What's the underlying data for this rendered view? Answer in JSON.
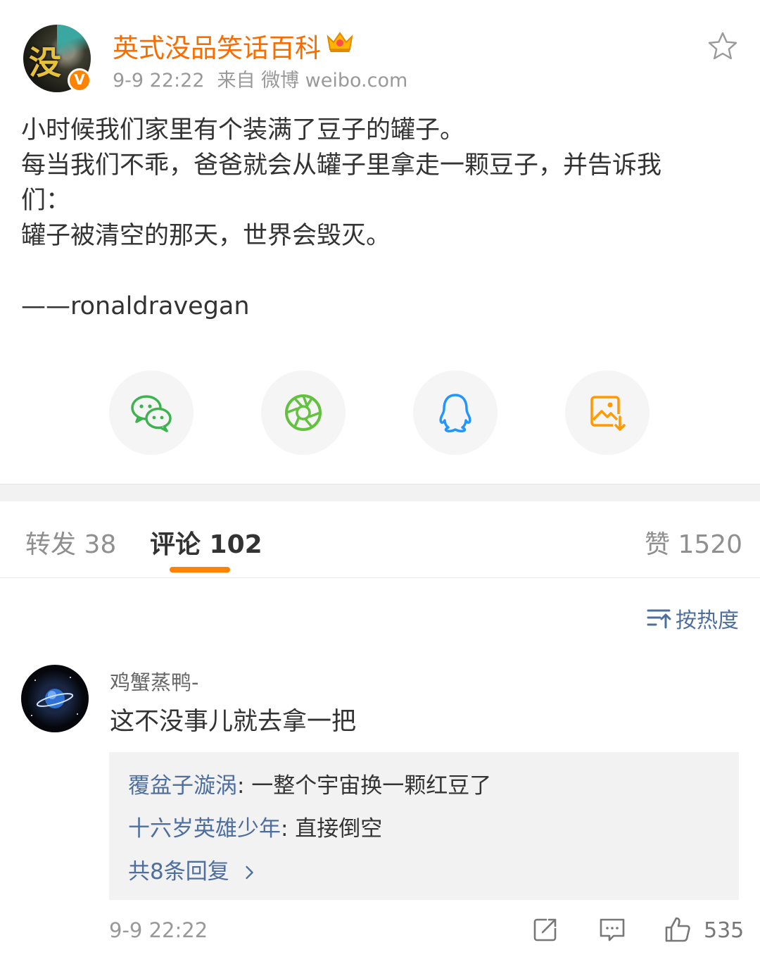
{
  "post": {
    "author": "英式没品笑话百科",
    "avatar_text": "没",
    "verified_badge": "V",
    "time": "9-9 22:22",
    "source": "来自 微博 weibo.com",
    "lines": [
      "小时候我们家里有个装满了豆子的罐子。",
      "每当我们不乖，爸爸就会从罐子里拿走一颗豆子，并告诉我",
      "们：",
      "罐子被清空的那天，世界会毁灭。",
      "",
      "——ronaldravegan"
    ]
  },
  "share_buttons": [
    {
      "icon": "wechat-icon",
      "color": "#3cb34f"
    },
    {
      "icon": "moments-icon",
      "color": "#62c13f"
    },
    {
      "icon": "qq-icon",
      "color": "#2395ff"
    },
    {
      "icon": "save-image-icon",
      "color": "#ff9a00"
    }
  ],
  "tabs": {
    "repost": "转发 38",
    "comments": "评论 102",
    "likes": "赞 1520"
  },
  "sort": {
    "label": "按热度"
  },
  "comment": {
    "user": "鸡蟹蒸鸭-",
    "text": "这不没事儿就去拿一把",
    "replies": [
      {
        "user": "覆盆子漩涡",
        "text": ": 一整个宇宙换一颗红豆了"
      },
      {
        "user": "十六岁英雄少年",
        "text": ": 直接倒空"
      }
    ],
    "more_replies": "共8条回复",
    "time": "9-9 22:22",
    "like_count": "535"
  },
  "colors": {
    "accent": "#ff8200",
    "name": "#f96c00",
    "link": "#4e6f9e"
  }
}
